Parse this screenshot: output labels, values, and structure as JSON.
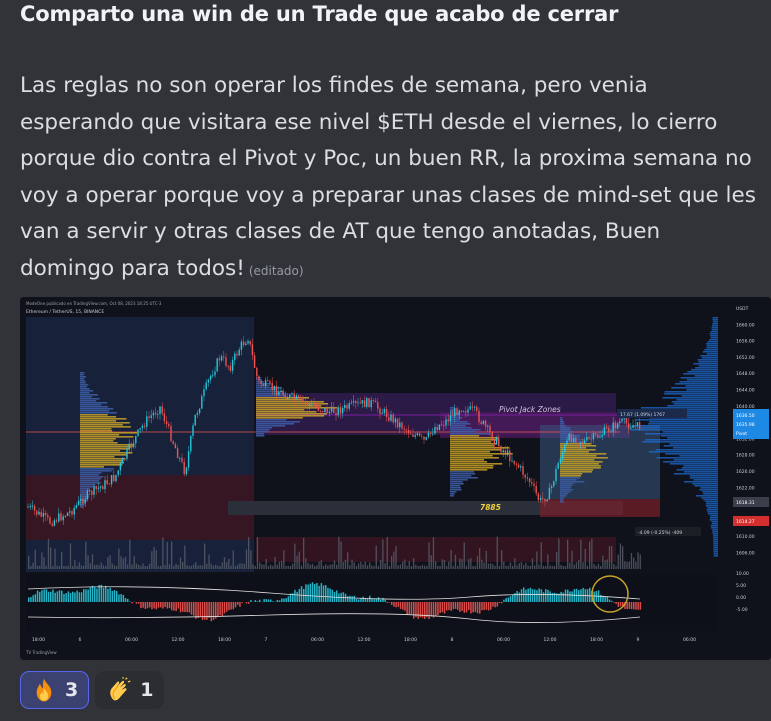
{
  "message": {
    "title": "Comparto una win de un Trade que acabo de cerrar",
    "body": "Las reglas no son operar los findes de semana, pero venia esperando que visitara ese nivel $ETH desde el viernes, lo cierro porque dio contra el Pivot y Poc, un buen RR, la proxima semana no voy a operar porque voy a preparar unas clases de mind-set que les van a servir y otras clases de AT que tengo anotadas, Buen domingo para todos!",
    "edited": "(editado)"
  },
  "chart": {
    "header": "ModeOne publicado en TradingView.com, Oct 08, 2023 18:25 UTC-3",
    "symbol": "Ethereum / TetherUS, 15, BINANCE",
    "zone_label": "Pivot Jack Zones",
    "level_label": "7885",
    "box_label_top": "17.67 (1.09%) 1767",
    "box_label_bottom": "-4.09 (-0.25%) -409",
    "price_labels": [
      "USDT",
      "1660.00",
      "1656.00",
      "1652.00",
      "1648.00",
      "1644.00",
      "1640.00",
      "1636.00",
      "1632.00",
      "1628.00",
      "1626.00",
      "1622.00",
      "1618.00",
      "1614.00",
      "1610.00",
      "1606.00"
    ],
    "price_tags": {
      "current": "1636.50",
      "blue2": "1635.98",
      "poc": "Pivot",
      "gray": "1618.31",
      "red": "1614.27"
    },
    "osc_labels": [
      "10.00",
      "5.00",
      "0.00",
      "-5.00"
    ],
    "time_labels": [
      "18:00",
      "6",
      "06:00",
      "12:00",
      "18:00",
      "7",
      "06:00",
      "12:00",
      "18:00",
      "8",
      "06:00",
      "12:00",
      "18:00",
      "9",
      "06:00"
    ],
    "footer": "TV TradingView"
  },
  "reactions": [
    {
      "emoji": "fire",
      "count": "3",
      "active": true
    },
    {
      "emoji": "clap",
      "count": "1",
      "active": false
    }
  ],
  "colors": {
    "up": "#26c6da",
    "down": "#ef5350",
    "zone": "#7b1fa2",
    "profile": "#c9a227"
  }
}
